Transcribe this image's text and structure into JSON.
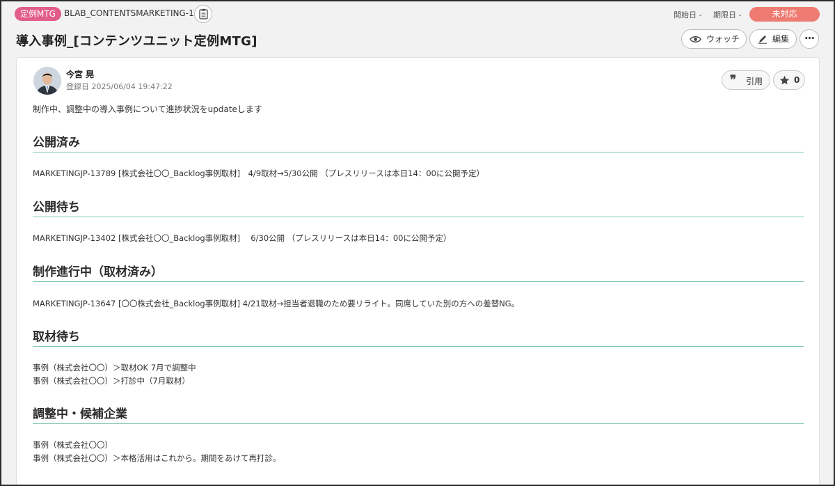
{
  "header": {
    "category_badge": "定例MTG",
    "issue_key": "BLAB_CONTENTSMARKETING-11",
    "copy_icon": "clipboard-icon",
    "start_date_label": "開始日 -",
    "due_date_label": "期限日 -",
    "status": "未対応"
  },
  "title": "導入事例_[コンテンツユニット定例MTG]",
  "actions": {
    "watch_label": "ウォッチ",
    "edit_label": "編集",
    "more_label": "•••"
  },
  "post": {
    "author": "今宮 晃",
    "registered": "登録日  2025/06/04 19:47:22",
    "quote_label": "引用",
    "star_count": "0",
    "intro": "制作中、調整中の導入事例について進捗状況をupdateします"
  },
  "sections": [
    {
      "title": "公開済み",
      "lines": [
        "MARKETINGJP-13789 [株式会社〇〇_Backlog事例取材]　4/9取材→5/30公開 （プレスリリースは本日14：00に公開予定）"
      ]
    },
    {
      "title": "公開待ち",
      "lines": [
        "MARKETINGJP-13402 [株式会社〇〇_Backlog事例取材]　 6/30公開 （プレスリリースは本日14：00に公開予定）"
      ]
    },
    {
      "title": "制作進行中（取材済み）",
      "lines": [
        "MARKETINGJP-13647 [〇〇株式会社_Backlog事例取材] 4/21取材→担当者退職のため要リライト。同席していた別の方への差替NG。"
      ]
    },
    {
      "title": "取材待ち",
      "lines": [
        "事例（株式会社〇〇）＞取材OK 7月で調整中",
        "事例（株式会社〇〇）＞打診中（7月取材）"
      ]
    },
    {
      "title": "調整中・候補企業",
      "lines": [
        "事例（株式会社〇〇）",
        "事例（株式会社〇〇）＞本格活用はこれから。期間をあけて再打診。"
      ]
    }
  ],
  "colors": {
    "category": "#e25d8a",
    "status": "#ee7b72",
    "section_rule": "#7ccaa8"
  }
}
